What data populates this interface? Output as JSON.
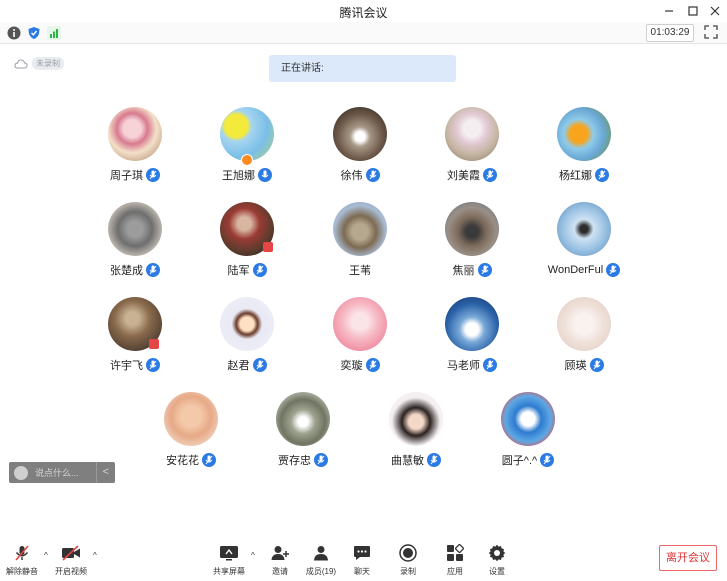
{
  "window": {
    "title": "腾讯会议"
  },
  "infobar": {
    "timer": "01:03:29"
  },
  "cloud": {
    "label": "未录制"
  },
  "speaking": {
    "label": "正在讲话:"
  },
  "participants": [
    {
      "name": "周子琪"
    },
    {
      "name": "王旭娜"
    },
    {
      "name": "徐伟"
    },
    {
      "name": "刘美霞"
    },
    {
      "name": "杨红娜"
    },
    {
      "name": "张楚成"
    },
    {
      "name": "陆军"
    },
    {
      "name": "王苇"
    },
    {
      "name": "焦丽"
    },
    {
      "name": "WonDerFul"
    },
    {
      "name": "许宇飞"
    },
    {
      "name": "赵君"
    },
    {
      "name": "奕璇"
    },
    {
      "name": "马老师"
    },
    {
      "name": "顾瑛"
    },
    {
      "name": "安花花"
    },
    {
      "name": "贾存忠"
    },
    {
      "name": "曲慧敏"
    },
    {
      "name": "圆子^.^"
    }
  ],
  "chat": {
    "placeholder": "说点什么..."
  },
  "toolbar": {
    "unmute": "解除静音",
    "video": "开启视频",
    "share": "共享屏幕",
    "invite": "邀请",
    "members": "成员(19)",
    "chat": "聊天",
    "record": "录制",
    "apps": "应用",
    "settings": "设置",
    "leave": "离开会议"
  },
  "colors": {
    "accent": "#2c7be5",
    "danger": "#e64545",
    "banner": "#dbe9fb"
  }
}
